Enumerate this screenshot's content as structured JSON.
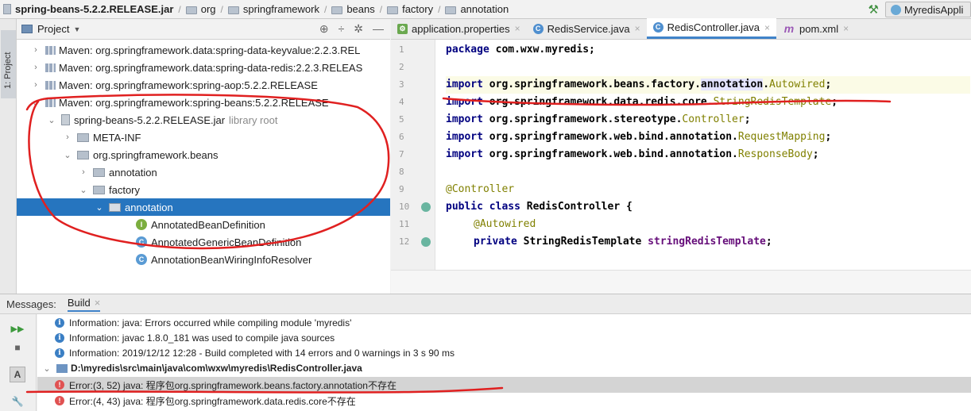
{
  "breadcrumbs": [
    "spring-beans-5.2.2.RELEASE.jar",
    "org",
    "springframework",
    "beans",
    "factory",
    "annotation"
  ],
  "run_config": "MyredisAppli",
  "side_tab": "1: Project",
  "project_panel": {
    "title": "Project",
    "tree": [
      {
        "text": "Maven: org.springframework.data:spring-data-keyvalue:2.2.3.REL",
        "arrow": "›"
      },
      {
        "text": "Maven: org.springframework.data:spring-data-redis:2.2.3.RELEAS",
        "arrow": "›"
      },
      {
        "text": "Maven: org.springframework:spring-aop:5.2.2.RELEASE",
        "arrow": "›"
      },
      {
        "text": "Maven: org.springframework:spring-beans:5.2.2.RELEASE",
        "arrow": "⌄"
      },
      {
        "text": "spring-beans-5.2.2.RELEASE.jar",
        "suffix": "library root",
        "arrow": "⌄"
      },
      {
        "text": "META-INF",
        "arrow": "›"
      },
      {
        "text": "org.springframework.beans",
        "arrow": "⌄"
      },
      {
        "text": "annotation",
        "arrow": "›"
      },
      {
        "text": "factory",
        "arrow": "⌄"
      },
      {
        "text": "annotation",
        "arrow": "⌄"
      },
      {
        "text": "AnnotatedBeanDefinition",
        "badge": "I"
      },
      {
        "text": "AnnotatedGenericBeanDefinition",
        "badge": "C"
      },
      {
        "text": "AnnotationBeanWiringInfoResolver",
        "badge": "C"
      }
    ]
  },
  "editor": {
    "tabs": [
      {
        "label": "application.properties",
        "icon": "⚙"
      },
      {
        "label": "RedisService.java",
        "icon": "C"
      },
      {
        "label": "RedisController.java",
        "icon": "C"
      },
      {
        "label": "pom.xml",
        "icon": "m"
      }
    ],
    "line_numbers": [
      "1",
      "2",
      "3",
      "4",
      "5",
      "6",
      "7",
      "8",
      "9",
      "10",
      "11",
      "12"
    ],
    "code": {
      "l1_kw": "package",
      "l1_rest": " com.wxw.myredis;",
      "import_kw": "import",
      "l3_pkg": " org.springframework.beans.factory.",
      "l3_ref": "annotation",
      "l3_cls": "Autowired",
      "semi": ";",
      "l4_pkg": " org.springframework.data.redis.core.",
      "l4_cls": "StringRedisTemplate",
      "l5_pkg": " org.springframework.stereotype.",
      "l5_cls": "Controller",
      "l6_pkg": " org.springframework.web.bind.annotation.",
      "l6_cls": "RequestMapping",
      "l7_pkg": " org.springframework.web.bind.annotation.",
      "l7_cls": "ResponseBody",
      "l9_an": "@Controller",
      "l10_kw": "public class",
      "l10_rest": " RedisController {",
      "l11_an": "@Autowired",
      "l12_kw": "private",
      "l12_type": " StringRedisTemplate ",
      "l12_fld": "stringRedisTemplate",
      "l12_end": ";"
    }
  },
  "messages": {
    "label": "Messages:",
    "tab": "Build",
    "rows": [
      {
        "type": "info",
        "text": "Information: java: Errors occurred while compiling module 'myredis'"
      },
      {
        "type": "info",
        "text": "Information: javac 1.8.0_181 was used to compile java sources"
      },
      {
        "type": "info",
        "text": "Information: 2019/12/12 12:28 - Build completed with 14 errors and 0 warnings in 3 s 90 ms"
      },
      {
        "type": "file",
        "text": "D:\\myredis\\src\\main\\java\\com\\wxw\\myredis\\RedisController.java"
      },
      {
        "type": "error",
        "text": "Error:(3, 52)  java: 程序包org.springframework.beans.factory.annotation不存在"
      },
      {
        "type": "error",
        "text": "Error:(4, 43)  java: 程序包org.springframework.data.redis.core不存在"
      }
    ]
  },
  "colors": {
    "selection": "#2675bf",
    "annotation_ink": "#e02020",
    "error": "#e05252",
    "info": "#3b7fc4"
  }
}
